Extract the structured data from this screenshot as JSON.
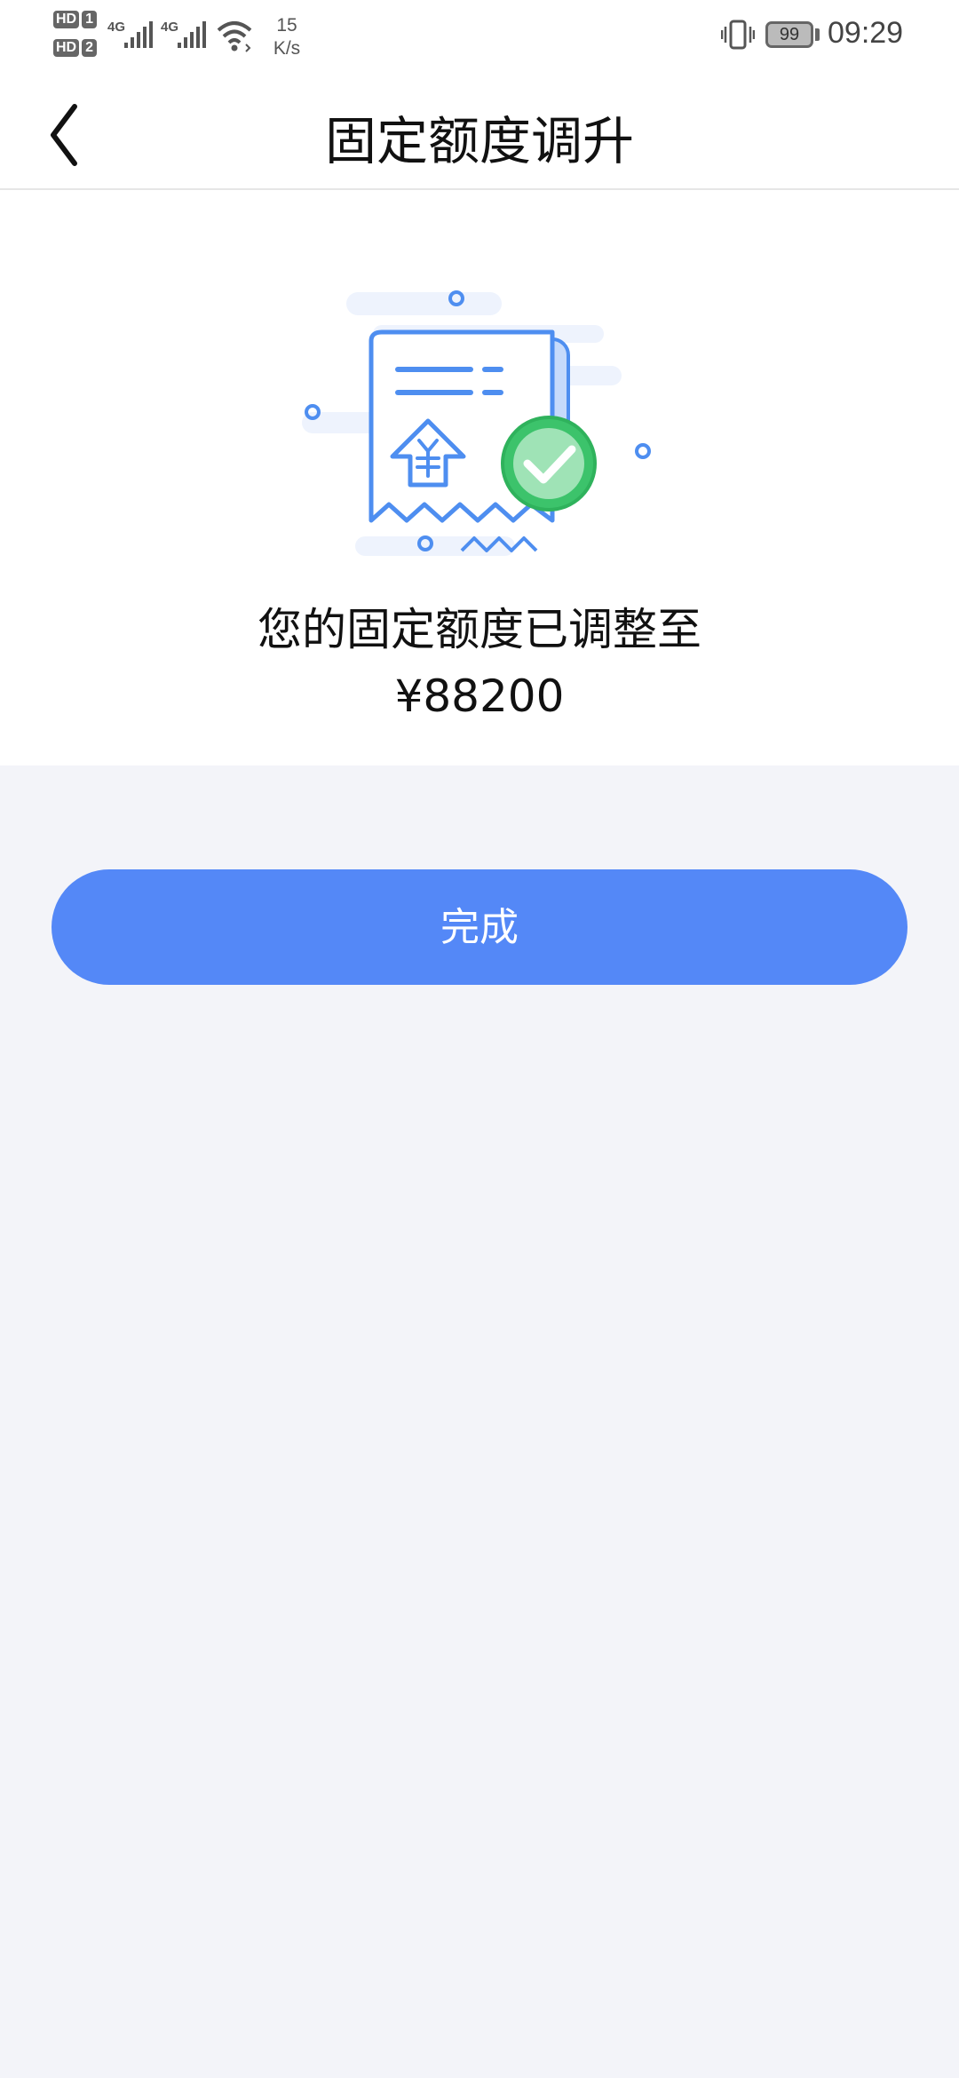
{
  "status_bar": {
    "sim1_label": "HD",
    "sim1_num": "1",
    "sim2_label": "HD",
    "sim2_num": "2",
    "network1": "4G",
    "network2": "4G",
    "speed_value": "15",
    "speed_unit": "K/s",
    "battery": "99",
    "time": "09:29",
    "icons": [
      "signal-icon",
      "wifi-icon",
      "vibrate-icon",
      "battery-icon"
    ]
  },
  "nav": {
    "title": "固定额度调升",
    "back_icon": "chevron-left-icon"
  },
  "result": {
    "message": "您的固定额度已调整至",
    "amount": "¥88200",
    "illustration_icon": "receipt-success-icon"
  },
  "actions": {
    "done_label": "完成"
  },
  "colors": {
    "accent": "#5488f7",
    "success": "#3cc36b",
    "background": "#f3f4f9"
  }
}
